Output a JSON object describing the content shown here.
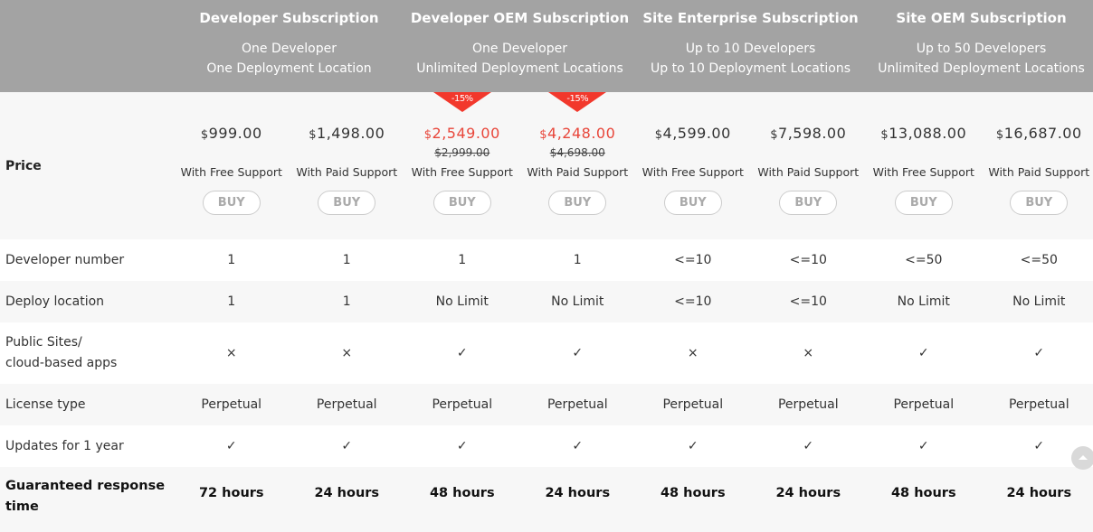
{
  "plans": [
    {
      "title": "Developer Subscription",
      "line1": "One Developer",
      "line2": "One Deployment Location"
    },
    {
      "title": "Developer OEM Subscription",
      "line1": "One Developer",
      "line2": "Unlimited Deployment Locations"
    },
    {
      "title": "Site Enterprise Subscription",
      "line1": "Up to 10 Developers",
      "line2": "Up to 10 Deployment Locations"
    },
    {
      "title": "Site OEM Subscription",
      "line1": "Up to 50 Developers",
      "line2": "Unlimited Deployment Locations"
    }
  ],
  "price_row": {
    "label": "Price",
    "buy_label": "BUY",
    "currency": "$",
    "accent_color": "#e8463a",
    "options": [
      {
        "price": "999.00",
        "old_price": "",
        "discount": "",
        "support": "With Free Support"
      },
      {
        "price": "1,498.00",
        "old_price": "",
        "discount": "",
        "support": "With Paid Support"
      },
      {
        "price": "2,549.00",
        "old_price": "$2,999.00",
        "discount": "-15%",
        "support": "With Free Support"
      },
      {
        "price": "4,248.00",
        "old_price": "$4,698.00",
        "discount": "-15%",
        "support": "With Paid Support"
      },
      {
        "price": "4,599.00",
        "old_price": "",
        "discount": "",
        "support": "With Free Support"
      },
      {
        "price": "7,598.00",
        "old_price": "",
        "discount": "",
        "support": "With Paid Support"
      },
      {
        "price": "13,088.00",
        "old_price": "",
        "discount": "",
        "support": "With Free Support"
      },
      {
        "price": "16,687.00",
        "old_price": "",
        "discount": "",
        "support": "With Paid Support"
      }
    ]
  },
  "rows": [
    {
      "label": "Developer number",
      "values": [
        "1",
        "1",
        "1",
        "1",
        "<=10",
        "<=10",
        "<=50",
        "<=50"
      ]
    },
    {
      "label": "Deploy location",
      "values": [
        "1",
        "1",
        "No Limit",
        "No Limit",
        "<=10",
        "<=10",
        "No Limit",
        "No Limit"
      ]
    },
    {
      "label1": "Public Sites/",
      "label2": "cloud-based apps",
      "values": [
        "×",
        "×",
        "✓",
        "✓",
        "×",
        "×",
        "✓",
        "✓"
      ]
    },
    {
      "label": "License type",
      "values": [
        "Perpetual",
        "Perpetual",
        "Perpetual",
        "Perpetual",
        "Perpetual",
        "Perpetual",
        "Perpetual",
        "Perpetual"
      ]
    },
    {
      "label": "Updates for 1 year",
      "values": [
        "✓",
        "✓",
        "✓",
        "✓",
        "✓",
        "✓",
        "✓",
        "✓"
      ]
    },
    {
      "label1": "Guaranteed response",
      "label2": "time",
      "values": [
        "72 hours",
        "24 hours",
        "48 hours",
        "24 hours",
        "48 hours",
        "24 hours",
        "48 hours",
        "24 hours"
      ]
    }
  ],
  "scroll_top_icon": "chevron-up-icon"
}
